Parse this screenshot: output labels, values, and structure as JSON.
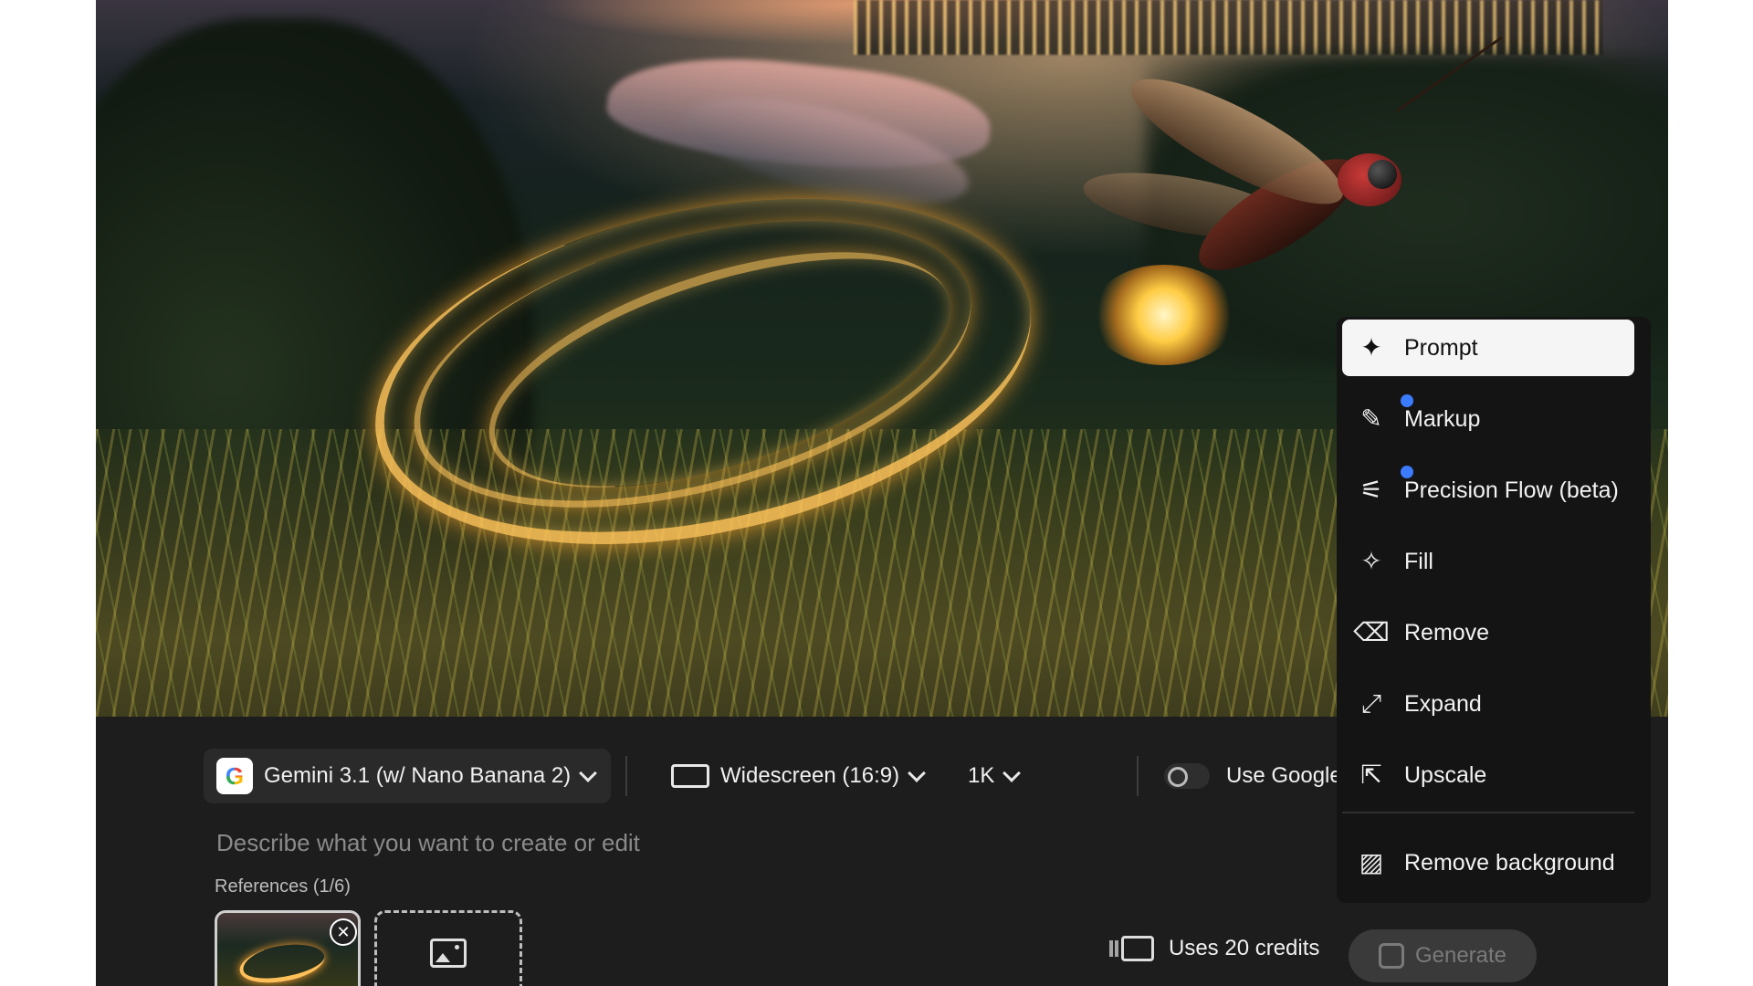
{
  "toolbar": {
    "model_label": "Gemini 3.1 (w/ Nano Banana 2)",
    "model_logo_letter": "G",
    "aspect_label": "Widescreen (16:9)",
    "resolution_label": "1K",
    "google_search_label": "Use Google Search",
    "google_search_enabled": false
  },
  "prompt": {
    "placeholder": "Describe what you want to create or edit",
    "value": ""
  },
  "references": {
    "label": "References (1/6)",
    "remove_glyph": "✕"
  },
  "footer": {
    "credits_label": "Uses 20 credits",
    "generate_label": "Generate"
  },
  "menu": {
    "items": [
      {
        "label": "Prompt",
        "icon": "prompt-icon",
        "glyph": "✦",
        "active": true
      },
      {
        "label": "Markup",
        "icon": "markup-icon",
        "glyph": "✎",
        "new_badge": true
      },
      {
        "label": "Precision Flow (beta)",
        "icon": "precision-flow-icon",
        "glyph": "⚟",
        "new_badge": true
      },
      {
        "label": "Fill",
        "icon": "fill-icon",
        "glyph": "✧"
      },
      {
        "label": "Remove",
        "icon": "remove-icon",
        "glyph": "⌫"
      },
      {
        "label": "Expand",
        "icon": "expand-icon",
        "glyph": "⤢"
      },
      {
        "label": "Upscale",
        "icon": "upscale-icon",
        "glyph": "⇱"
      },
      {
        "label": "Remove background",
        "icon": "remove-background-icon",
        "glyph": "▨"
      }
    ]
  },
  "colors": {
    "panel_bg": "#1d1d1d",
    "menu_bg": "#141414",
    "active_item_bg": "#f5f5f5",
    "badge_blue": "#3b7bff"
  }
}
